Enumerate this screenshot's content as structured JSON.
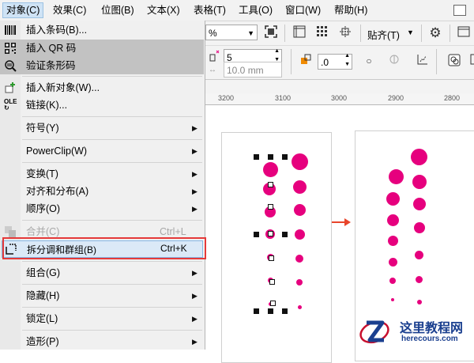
{
  "menubar": {
    "items": [
      "对象(C)",
      "效果(C)",
      "位图(B)",
      "文本(X)",
      "表格(T)",
      "工具(O)",
      "窗口(W)",
      "帮助(H)"
    ]
  },
  "menu": {
    "items": [
      {
        "label": "插入条码(B)...",
        "icon": "barcode-icon"
      },
      {
        "label": "插入 QR 码",
        "icon": "qr-code-icon"
      },
      {
        "label": "验证条形码",
        "icon": "verify-barcode-icon"
      },
      {
        "label": "插入新对象(W)...",
        "icon": "insert-object-icon"
      },
      {
        "label": "链接(K)...",
        "icon": "ole-link-icon"
      },
      {
        "label": "符号(Y)"
      },
      {
        "label": "PowerClip(W)"
      },
      {
        "label": "变换(T)"
      },
      {
        "label": "对齐和分布(A)"
      },
      {
        "label": "顺序(O)"
      },
      {
        "label": "合并(C)",
        "shortcut": "Ctrl+L"
      },
      {
        "label": "拆分调和群组(B)",
        "shortcut": "Ctrl+K"
      },
      {
        "label": "组合(G)"
      },
      {
        "label": "隐藏(H)"
      },
      {
        "label": "锁定(L)"
      },
      {
        "label": "造形(P)"
      }
    ]
  },
  "toolbar": {
    "percent": "%",
    "snap_label": "贴齐(T)",
    "size_value": "5",
    "size_mm": "10.0 mm",
    "opacity_value": ".0"
  },
  "ruler": {
    "labels": [
      "3200",
      "3100",
      "3000",
      "2900",
      "2800"
    ]
  },
  "watermark": {
    "title": "这里教程网",
    "url": "herecours.com"
  },
  "colors": {
    "accent": "#e6007e",
    "highlight_border": "#e53a3a",
    "selection": "#dbe9f7"
  }
}
